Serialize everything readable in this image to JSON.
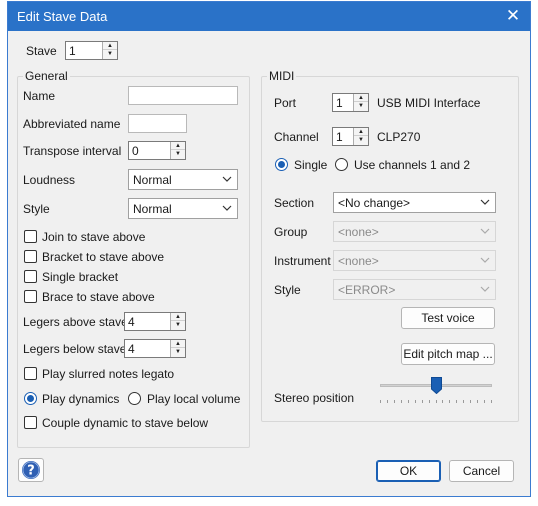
{
  "window": {
    "title": "Edit Stave Data",
    "close_glyph": "✕"
  },
  "stave": {
    "label": "Stave",
    "value": "1"
  },
  "general": {
    "title": "General",
    "name_label": "Name",
    "name_value": "",
    "abbrev_label": "Abbreviated name",
    "abbrev_value": "",
    "transpose_label": "Transpose interval",
    "transpose_value": "0",
    "loudness_label": "Loudness",
    "loudness_value": "Normal",
    "style_label": "Style",
    "style_value": "Normal",
    "join_label": "Join to stave above",
    "bracket_label": "Bracket to stave above",
    "single_bracket_label": "Single bracket",
    "brace_label": "Brace to stave above",
    "legers_above_label": "Legers above stave",
    "legers_above_value": "4",
    "legers_below_label": "Legers below stave",
    "legers_below_value": "4",
    "slurred_label": "Play slurred notes legato",
    "play_dynamics_label": "Play dynamics",
    "play_local_volume_label": "Play local volume",
    "couple_label": "Couple dynamic to stave below"
  },
  "midi": {
    "title": "MIDI",
    "port_label": "Port",
    "port_value": "1",
    "port_name": "USB MIDI Interface",
    "channel_label": "Channel",
    "channel_value": "1",
    "channel_name": "CLP270",
    "single_label": "Single",
    "use_channels_label": "Use channels 1 and 2",
    "section_label": "Section",
    "section_value": "<No change>",
    "group_label": "Group",
    "group_value": "<none>",
    "instrument_label": "Instrument",
    "instrument_value": "<none>",
    "style_label": "Style",
    "style_value": "<ERROR>",
    "test_voice_label": "Test voice",
    "edit_pitch_label": "Edit pitch map ...",
    "stereo_label": "Stereo position",
    "stereo_position": 0.5
  },
  "footer": {
    "ok_label": "OK",
    "cancel_label": "Cancel"
  },
  "colors": {
    "accent": "#1a5fb4",
    "titlebar": "#2a72c8"
  }
}
